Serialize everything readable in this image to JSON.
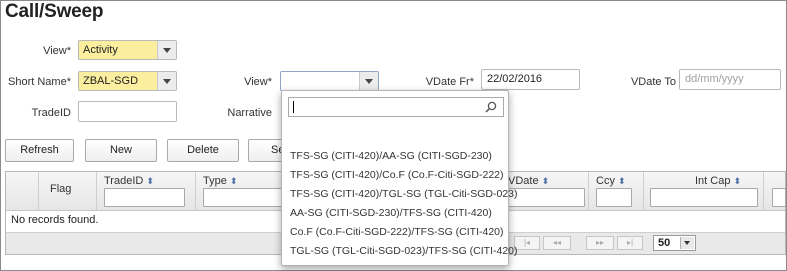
{
  "page": {
    "title": "Call/Sweep"
  },
  "form": {
    "view1": {
      "label": "View*",
      "value": "Activity"
    },
    "short_name": {
      "label": "Short Name*",
      "value": "ZBAL-SGD"
    },
    "view2": {
      "label": "View*",
      "value": ""
    },
    "vdate_from": {
      "label": "VDate Fr*",
      "value": "22/02/2016"
    },
    "vdate_to": {
      "label": "VDate To",
      "placeholder": "dd/mm/yyyy"
    },
    "trade_id": {
      "label": "TradeID",
      "value": ""
    },
    "narrative": {
      "label": "Narrative"
    }
  },
  "buttons": {
    "refresh": "Refresh",
    "new": "New",
    "delete": "Delete",
    "partial": "Se"
  },
  "grid": {
    "columns": {
      "flag": "Flag",
      "trade_id": "TradeID",
      "type": "Type",
      "vdate": "VDate",
      "ccy": "Ccy",
      "int_cap": "Int Cap"
    },
    "empty_message": "No records found.",
    "rows_per_page": "50",
    "pager_icons": [
      "first-page-icon",
      "prev-page-icon",
      "next-page-icon",
      "last-page-icon"
    ]
  },
  "dropdown": {
    "search_value": "",
    "options": [
      "TFS-SG (CITI-420)/AA-SG (CITI-SGD-230)",
      "TFS-SG (CITI-420)/Co.F (Co.F-Citi-SGD-222)",
      "TFS-SG (CITI-420)/TGL-SG (TGL-Citi-SGD-023)",
      "AA-SG (CITI-SGD-230)/TFS-SG (CITI-420)",
      "Co.F (Co.F-Citi-SGD-222)/TFS-SG (CITI-420)",
      "TGL-SG (TGL-Citi-SGD-023)/TFS-SG (CITI-420)"
    ]
  },
  "colors": {
    "required_field_bg": "#fbee9f",
    "border": "#b9b9b9",
    "sort_icon": "#4a6fa5"
  }
}
